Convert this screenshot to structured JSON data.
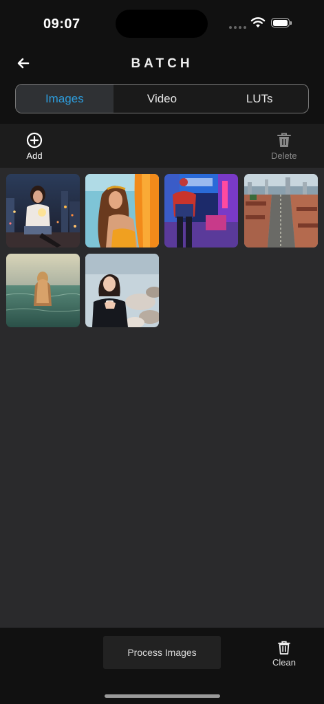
{
  "status": {
    "time": "09:07"
  },
  "header": {
    "title": "BATCH",
    "back_icon": "arrow-left-icon"
  },
  "tabs": [
    {
      "label": "Images",
      "active": true
    },
    {
      "label": "Video",
      "active": false
    },
    {
      "label": "LUTs",
      "active": false
    }
  ],
  "toolbar": {
    "add_label": "Add",
    "delete_label": "Delete"
  },
  "images": [
    {
      "description": "woman with sparkler on rooftop at night"
    },
    {
      "description": "woman with long hair in yellow top"
    },
    {
      "description": "man in red and blue jacket in Times Square"
    },
    {
      "description": "aerial city street view"
    },
    {
      "description": "woman in sea at sunset"
    },
    {
      "description": "woman in black sweater holding cup"
    }
  ],
  "bottom": {
    "process_label": "Process Images",
    "clean_label": "Clean"
  },
  "colors": {
    "accent": "#2d9cdb",
    "background": "#111111",
    "grid_bg": "#2a2a2c"
  }
}
